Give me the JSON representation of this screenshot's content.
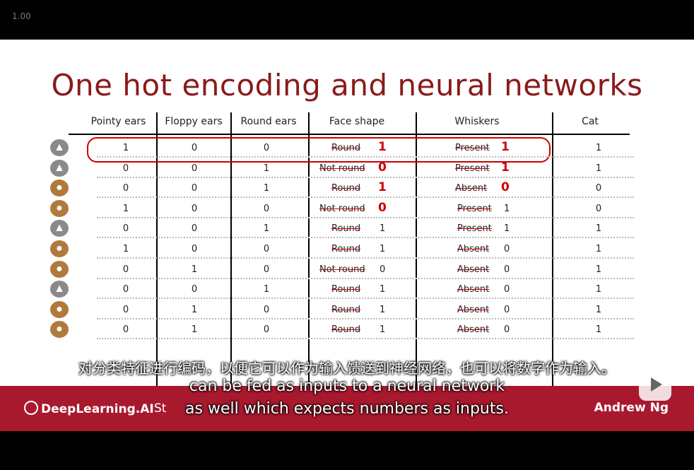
{
  "player": {
    "zoom": "1.00"
  },
  "slide": {
    "title": "One hot encoding and neural networks",
    "columns": [
      "Pointy ears",
      "Floppy ears",
      "Round ears",
      "Face shape",
      "Whiskers",
      "Cat"
    ],
    "rows": [
      {
        "pointy": "1",
        "floppy": "0",
        "round": "0",
        "face": "Round",
        "face_num": "1",
        "whiskers": "Present",
        "whiskers_num": "1",
        "cat": "1"
      },
      {
        "pointy": "0",
        "floppy": "0",
        "round": "1",
        "face": "Not round",
        "face_num": "0",
        "whiskers": "Present",
        "whiskers_num": "1",
        "cat": "1"
      },
      {
        "pointy": "0",
        "floppy": "0",
        "round": "1",
        "face": "Round",
        "face_num": "1",
        "whiskers": "Absent",
        "whiskers_num": "0",
        "cat": "0"
      },
      {
        "pointy": "1",
        "floppy": "0",
        "round": "0",
        "face": "Not round",
        "face_num": "0",
        "whiskers": "Present",
        "whiskers_num": "1",
        "cat": "0"
      },
      {
        "pointy": "0",
        "floppy": "0",
        "round": "1",
        "face": "Round",
        "face_num": "1",
        "whiskers": "Present",
        "whiskers_num": "1",
        "cat": "1"
      },
      {
        "pointy": "1",
        "floppy": "0",
        "round": "0",
        "face": "Round",
        "face_num": "1",
        "whiskers": "Absent",
        "whiskers_num": "0",
        "cat": "1"
      },
      {
        "pointy": "0",
        "floppy": "1",
        "round": "0",
        "face": "Not round",
        "face_num": "0",
        "whiskers": "Absent",
        "whiskers_num": "0",
        "cat": "1"
      },
      {
        "pointy": "0",
        "floppy": "0",
        "round": "1",
        "face": "Round",
        "face_num": "1",
        "whiskers": "Absent",
        "whiskers_num": "0",
        "cat": "1"
      },
      {
        "pointy": "0",
        "floppy": "1",
        "round": "0",
        "face": "Round",
        "face_num": "1",
        "whiskers": "Absent",
        "whiskers_num": "0",
        "cat": "1"
      },
      {
        "pointy": "0",
        "floppy": "1",
        "round": "0",
        "face": "Round",
        "face_num": "1",
        "whiskers": "Absent",
        "whiskers_num": "0",
        "cat": "1"
      }
    ],
    "animal_icons": [
      "cat-icon",
      "cat-icon",
      "dog-icon",
      "dog-icon",
      "cat-icon",
      "dog-icon",
      "dog-icon",
      "cat-icon",
      "dog-icon",
      "dog-icon"
    ]
  },
  "footer": {
    "brand": "DeepLearning.AI",
    "partner": "St",
    "author": "Andrew Ng"
  },
  "subtitles": {
    "cn": "对分类特征进行编码，以便它可以作为输入馈送到神经网络，也可以将数字作为输入。",
    "en1": "can be fed as inputs to a neural network",
    "en2": "as well which expects numbers as inputs."
  },
  "colors": {
    "accent": "#a8192e",
    "title": "#8b1a1a",
    "annotation": "#cc0000"
  }
}
